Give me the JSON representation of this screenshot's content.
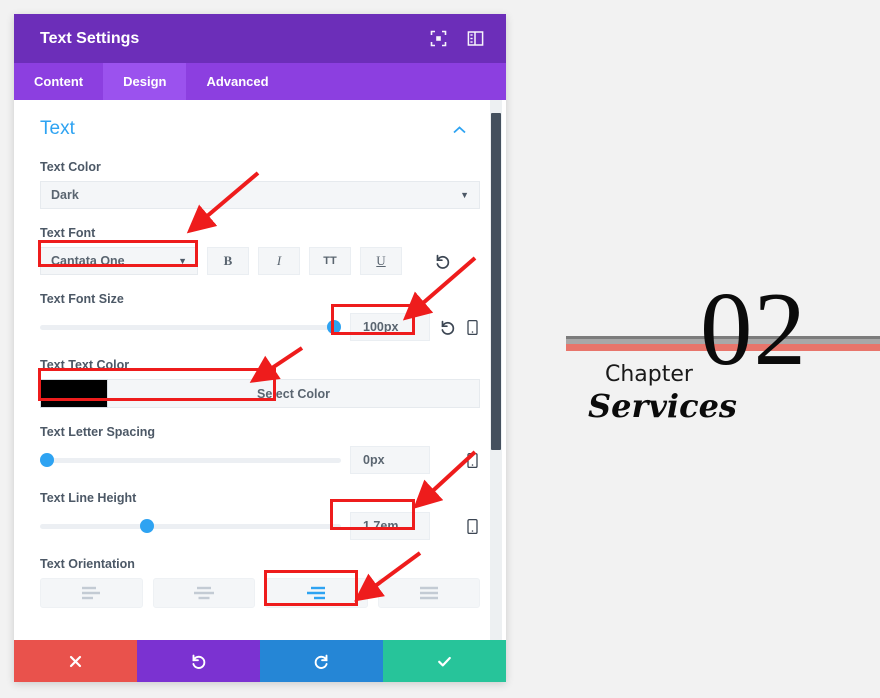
{
  "panel": {
    "title": "Text Settings",
    "header_icons": [
      {
        "name": "fullscreen-icon"
      },
      {
        "name": "panel-layout-icon"
      }
    ],
    "tabs": [
      {
        "label": "Content",
        "active": false
      },
      {
        "label": "Design",
        "active": true
      },
      {
        "label": "Advanced",
        "active": false
      }
    ],
    "section": {
      "title": "Text",
      "collapse_icon": "chevron-up-icon"
    },
    "fields": {
      "text_color": {
        "label": "Text Color",
        "value": "Dark",
        "caret": "▼"
      },
      "text_font": {
        "label": "Text Font",
        "value": "Cantata One",
        "caret": "▼",
        "format_buttons": [
          {
            "name": "bold-button",
            "label": "B"
          },
          {
            "name": "italic-button",
            "label": "I"
          },
          {
            "name": "uppercase-button",
            "label": "TT"
          },
          {
            "name": "underline-button",
            "label": "U"
          }
        ],
        "reset_icon": "reset-icon"
      },
      "text_font_size": {
        "label": "Text Font Size",
        "value": "100px",
        "slider_percent": 100,
        "reset_icon": "reset-icon",
        "device_icon": "mobile-icon"
      },
      "text_text_color": {
        "label": "Text Text Color",
        "swatch_color": "#000000",
        "button_label": "Select Color"
      },
      "text_letter_spacing": {
        "label": "Text Letter Spacing",
        "value": "0px",
        "slider_percent": 0,
        "device_icon": "mobile-icon"
      },
      "text_line_height": {
        "label": "Text Line Height",
        "value": "1.7em",
        "slider_percent": 35,
        "device_icon": "mobile-icon"
      },
      "text_orientation": {
        "label": "Text Orientation",
        "options": [
          {
            "name": "align-left-button",
            "icon": "align-left-icon",
            "selected": false
          },
          {
            "name": "align-center-button",
            "icon": "align-center-icon",
            "selected": false
          },
          {
            "name": "align-right-button",
            "icon": "align-right-icon",
            "selected": true
          },
          {
            "name": "align-justify-button",
            "icon": "align-justify-icon",
            "selected": false
          }
        ]
      }
    },
    "footer": [
      {
        "name": "cancel-button",
        "icon": "close-icon"
      },
      {
        "name": "undo-button",
        "icon": "undo-icon"
      },
      {
        "name": "redo-button",
        "icon": "redo-icon"
      },
      {
        "name": "save-button",
        "icon": "check-icon"
      }
    ]
  },
  "preview": {
    "number": "02",
    "label": "Chapter",
    "title": "Services",
    "divider_gray_color": "#8c8c8c",
    "divider_red_color": "#e8756b"
  },
  "annotation_color": "#ee1c1c",
  "theme": {
    "header_purple": "#6c2eb9",
    "tab_purple": "#8c3fe0",
    "tab_active_purple": "#9b52ee",
    "accent_blue": "#2ea3f2",
    "cancel_red": "#e9524c",
    "undo_purple": "#7b32d1",
    "redo_blue": "#2586d6",
    "save_teal": "#27c49a"
  }
}
